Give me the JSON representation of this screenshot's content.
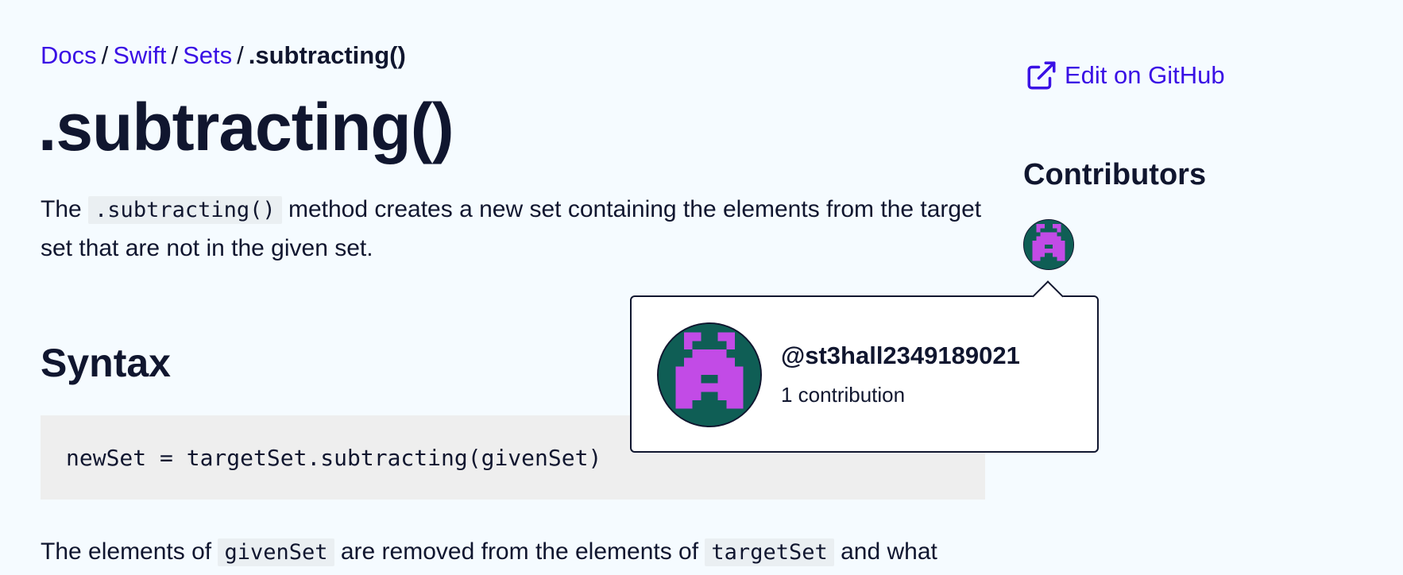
{
  "breadcrumb": {
    "items": [
      "Docs",
      "Swift",
      "Sets"
    ],
    "separator": "/",
    "current": ".subtracting()"
  },
  "page_title": ".subtracting()",
  "intro": {
    "part1": "The",
    "code": ".subtracting()",
    "part2": "method creates a new set containing the elements from the target set that are not in the given set."
  },
  "syntax": {
    "heading": "Syntax",
    "code": "newSet = targetSet.subtracting(givenSet)"
  },
  "paragraph2": {
    "part1": "The elements of",
    "code1": "givenSet",
    "part2": "are removed from the elements of",
    "code2": "targetSet",
    "part3": "and what"
  },
  "sidebar": {
    "edit_label": "Edit on GitHub",
    "contributors_heading": "Contributors"
  },
  "popover": {
    "username": "@st3hall2349189021",
    "contributions": "1 contribution"
  },
  "colors": {
    "background": "#f5fbff",
    "link": "#3a10e5",
    "text": "#10162f",
    "avatar_bg": "#0f5e55",
    "avatar_fg": "#c24be6"
  },
  "icons": [
    "external-link-icon",
    "pixel-invader-avatar"
  ]
}
